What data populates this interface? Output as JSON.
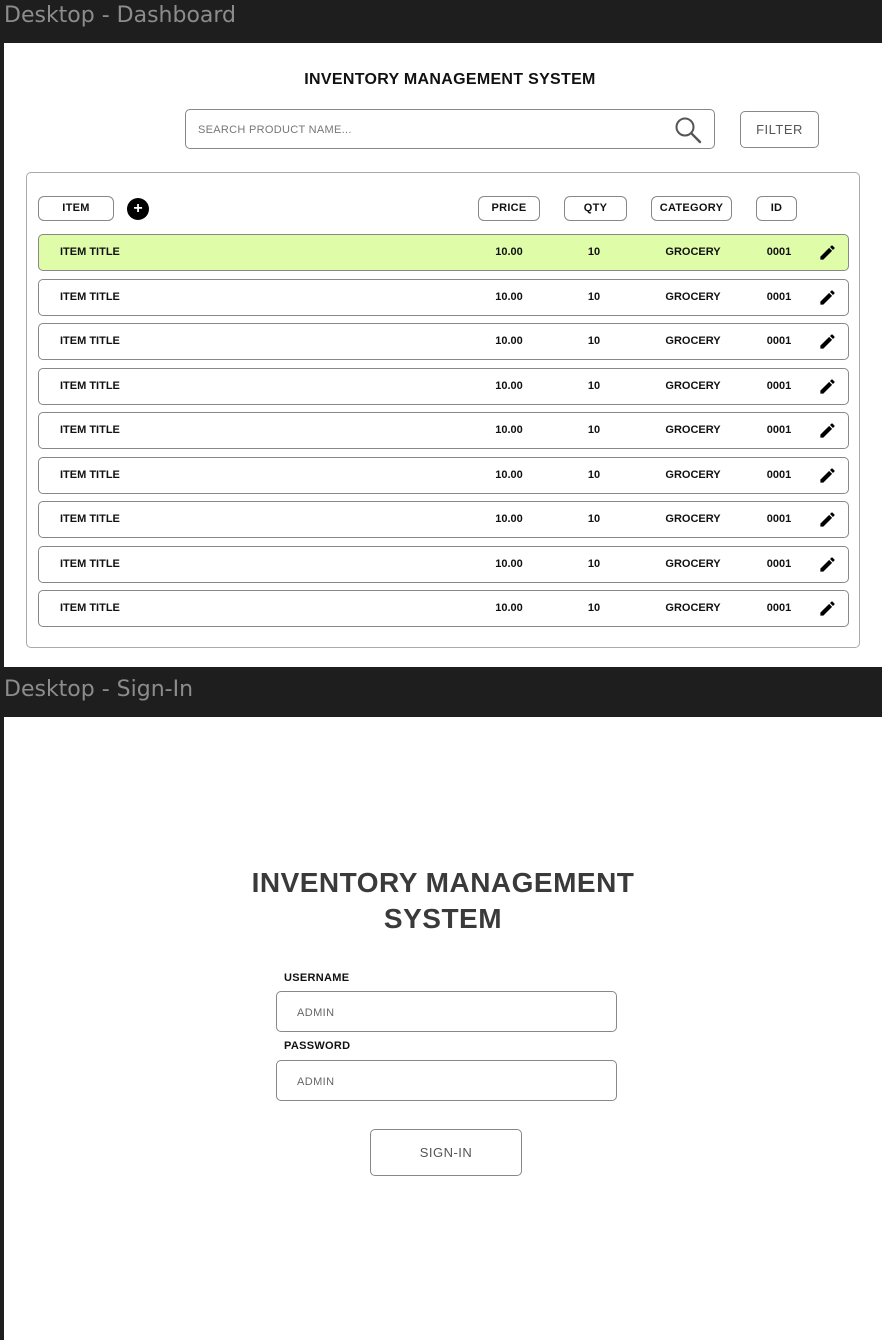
{
  "frames": {
    "dashboard_label": "Desktop - Dashboard",
    "signin_label": "Desktop - Sign-In"
  },
  "dashboard": {
    "title": "INVENTORY MANAGEMENT SYSTEM",
    "search_placeholder": "SEARCH PRODUCT NAME...",
    "search_icon": "search-icon",
    "filter_label": "FILTER",
    "columns": {
      "item": "ITEM",
      "price": "PRICE",
      "qty": "QTY",
      "category": "CATEGORY",
      "id": "ID"
    },
    "add_label": "+",
    "edit_icon": "pencil-icon",
    "selected_row_color": "#dffca9",
    "rows": [
      {
        "title": "ITEM TITLE",
        "price": "10.00",
        "qty": "10",
        "category": "GROCERY",
        "id": "0001"
      },
      {
        "title": "ITEM TITLE",
        "price": "10.00",
        "qty": "10",
        "category": "GROCERY",
        "id": "0001"
      },
      {
        "title": "ITEM TITLE",
        "price": "10.00",
        "qty": "10",
        "category": "GROCERY",
        "id": "0001"
      },
      {
        "title": "ITEM TITLE",
        "price": "10.00",
        "qty": "10",
        "category": "GROCERY",
        "id": "0001"
      },
      {
        "title": "ITEM TITLE",
        "price": "10.00",
        "qty": "10",
        "category": "GROCERY",
        "id": "0001"
      },
      {
        "title": "ITEM TITLE",
        "price": "10.00",
        "qty": "10",
        "category": "GROCERY",
        "id": "0001"
      },
      {
        "title": "ITEM TITLE",
        "price": "10.00",
        "qty": "10",
        "category": "GROCERY",
        "id": "0001"
      },
      {
        "title": "ITEM TITLE",
        "price": "10.00",
        "qty": "10",
        "category": "GROCERY",
        "id": "0001"
      },
      {
        "title": "ITEM TITLE",
        "price": "10.00",
        "qty": "10",
        "category": "GROCERY",
        "id": "0001"
      }
    ]
  },
  "signin": {
    "title_line1": "INVENTORY MANAGEMENT",
    "title_line2": "SYSTEM",
    "username_label": "USERNAME",
    "username_placeholder": "ADMIN",
    "password_label": "PASSWORD",
    "password_placeholder": "ADMIN",
    "signin_label": "SIGN-IN"
  }
}
